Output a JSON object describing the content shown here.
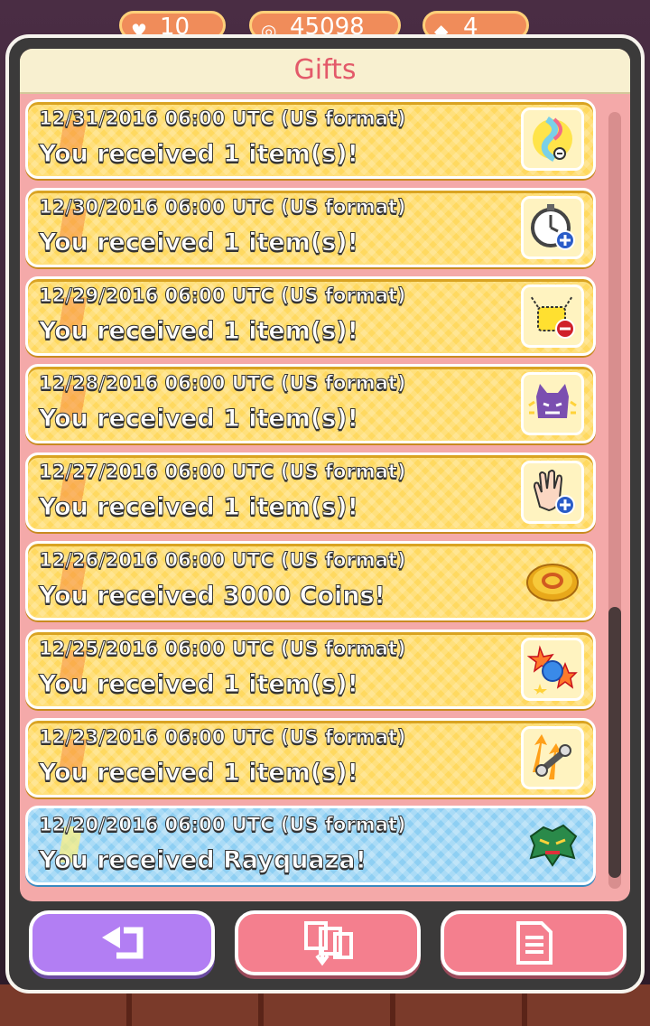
{
  "header": {
    "stats": [
      {
        "icon": "heart-icon",
        "value": "10"
      },
      {
        "icon": "coin-icon",
        "value": "45098"
      },
      {
        "icon": "jewel-icon",
        "value": "4"
      }
    ]
  },
  "dialog": {
    "title": "Gifts",
    "gifts": [
      {
        "date": "12/31/2016 06:00 UTC (US format)",
        "message": "You received 1 item(s)!",
        "icon": "mega-speedup-icon"
      },
      {
        "date": "12/30/2016 06:00 UTC (US format)",
        "message": "You received 1 item(s)!",
        "icon": "moves-plus-icon"
      },
      {
        "date": "12/29/2016 06:00 UTC (US format)",
        "message": "You received 1 item(s)!",
        "icon": "disruption-delay-icon"
      },
      {
        "date": "12/28/2016 06:00 UTC (US format)",
        "message": "You received 1 item(s)!",
        "icon": "complexity-minus-icon"
      },
      {
        "date": "12/27/2016 06:00 UTC (US format)",
        "message": "You received 1 item(s)!",
        "icon": "skill-booster-icon"
      },
      {
        "date": "12/26/2016 06:00 UTC (US format)",
        "message": "You received 3000 Coins!",
        "icon": "coin-icon"
      },
      {
        "date": "12/25/2016 06:00 UTC (US format)",
        "message": "You received 1 item(s)!",
        "icon": "attack-power-icon"
      },
      {
        "date": "12/23/2016 06:00 UTC (US format)",
        "message": "You received 1 item(s)!",
        "icon": "exp-booster-icon"
      },
      {
        "date": "12/20/2016 06:00 UTC (US format)",
        "message": "You received Rayquaza!",
        "icon": "rayquaza-icon"
      }
    ]
  },
  "buttons": {
    "back": "back-arrow-icon",
    "receive_all": "receive-all-icon",
    "history": "history-log-icon"
  },
  "colors": {
    "panel": "#f4a9a9",
    "row_yellow": "#ffd960",
    "row_blue": "#8ecff3",
    "title_text": "#e35a6a",
    "back_button": "#b27ef3",
    "action_button": "#f47f8e"
  }
}
